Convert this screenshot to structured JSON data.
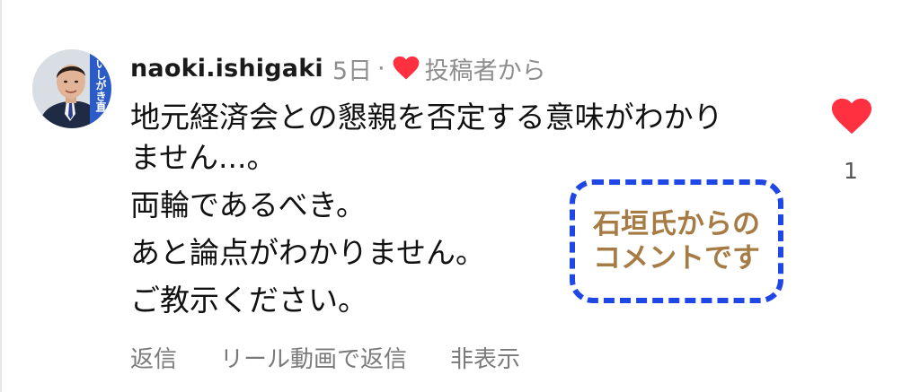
{
  "comment": {
    "username": "naoki.ishigaki",
    "time": "5日",
    "separator": "·",
    "author_liked": "投稿者から",
    "lines": [
      "地元経済会との懇親を否定する意味がわかり",
      "ません...。",
      "両輪であるべき。",
      "あと論点がわかりません。",
      "ご教示ください。"
    ],
    "like_count": "1"
  },
  "avatar": {
    "banner_text": "いしがき直"
  },
  "annotation": {
    "line1": "石垣氏からの",
    "line2": "コメントです",
    "border_color": "#1f47e6",
    "text_color": "#a67c44"
  },
  "actions": {
    "reply": "返信",
    "reel_reply": "リール動画で返信",
    "hide": "非表示"
  },
  "colors": {
    "heart": "#ff3040",
    "meta_text": "#8e8e8e"
  },
  "icons": {
    "author_heart": "heart-icon",
    "like": "heart-icon"
  }
}
